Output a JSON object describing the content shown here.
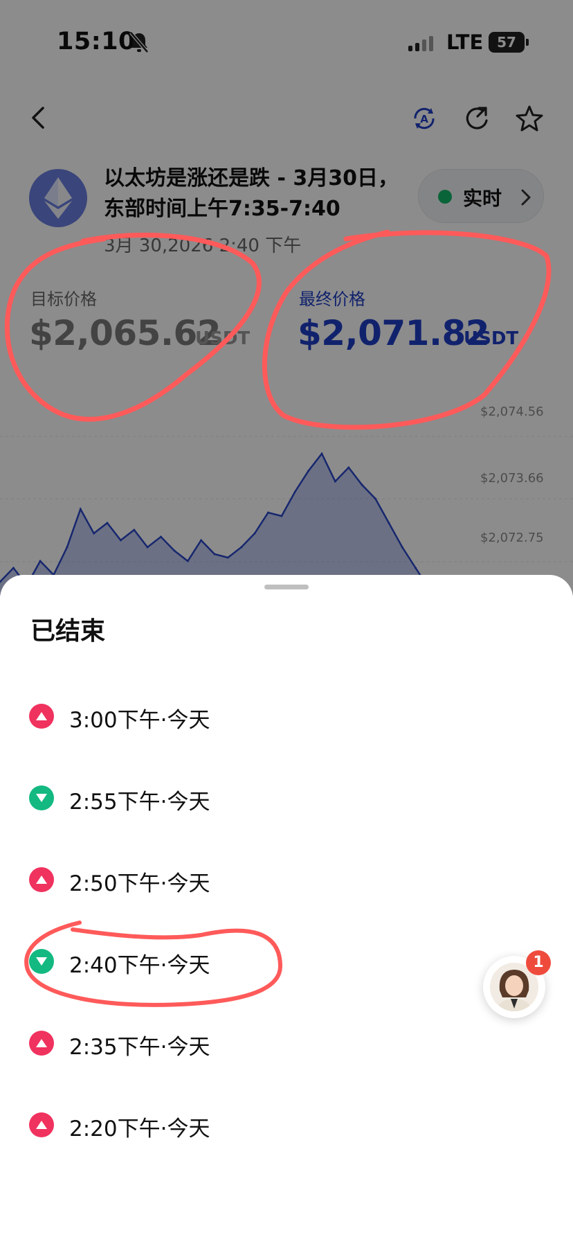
{
  "status_bar": {
    "time": "15:10",
    "network": "LTE",
    "battery": "57"
  },
  "nav": {
    "back_icon": "chevron-left-icon",
    "translate_icon": "translate-icon",
    "share_icon": "share-icon",
    "favorite_icon": "star-icon"
  },
  "market": {
    "title": "以太坊是涨还是跌 - 3月30日，东部时间上午7:35-7:40",
    "date": "3月 30,2026 2:40 下午",
    "live_label": "实时"
  },
  "prices": {
    "target_label": "目标价格",
    "target_value": "$2,065.62",
    "target_unit": "USDT",
    "final_label": "最终价格",
    "final_value": "$2,071.82",
    "final_unit": "USDT"
  },
  "chart_data": {
    "type": "area",
    "y_ticks": [
      "$2,074.56",
      "$2,073.66",
      "$2,072.75"
    ],
    "y_range": [
      2071.9,
      2074.9
    ],
    "grid": true,
    "series": [
      {
        "values": [
          2072.1,
          2072.3,
          2072.05,
          2072.4,
          2072.2,
          2072.6,
          2073.15,
          2072.8,
          2072.95,
          2072.7,
          2072.85,
          2072.6,
          2072.75,
          2072.55,
          2072.4,
          2072.7,
          2072.5,
          2072.45,
          2072.6,
          2072.8,
          2073.1,
          2073.05,
          2073.4,
          2073.7,
          2073.95,
          2073.55,
          2073.75,
          2073.5,
          2073.3,
          2072.95,
          2072.6,
          2072.3,
          2072.0
        ]
      }
    ],
    "color": "#2a47c9"
  },
  "sheet": {
    "title": "已结束",
    "rounds": [
      {
        "label": "3:00下午·今天",
        "direction": "up"
      },
      {
        "label": "2:55下午·今天",
        "direction": "down"
      },
      {
        "label": "2:50下午·今天",
        "direction": "up"
      },
      {
        "label": "2:40下午·今天",
        "direction": "down"
      },
      {
        "label": "2:35下午·今天",
        "direction": "up"
      },
      {
        "label": "2:20下午·今天",
        "direction": "up"
      }
    ]
  },
  "assistant": {
    "badge_count": "1"
  },
  "colors": {
    "up": "#f0325e",
    "down": "#13b981",
    "accent": "#1f3fc6",
    "annotation": "#ff5a5a"
  }
}
